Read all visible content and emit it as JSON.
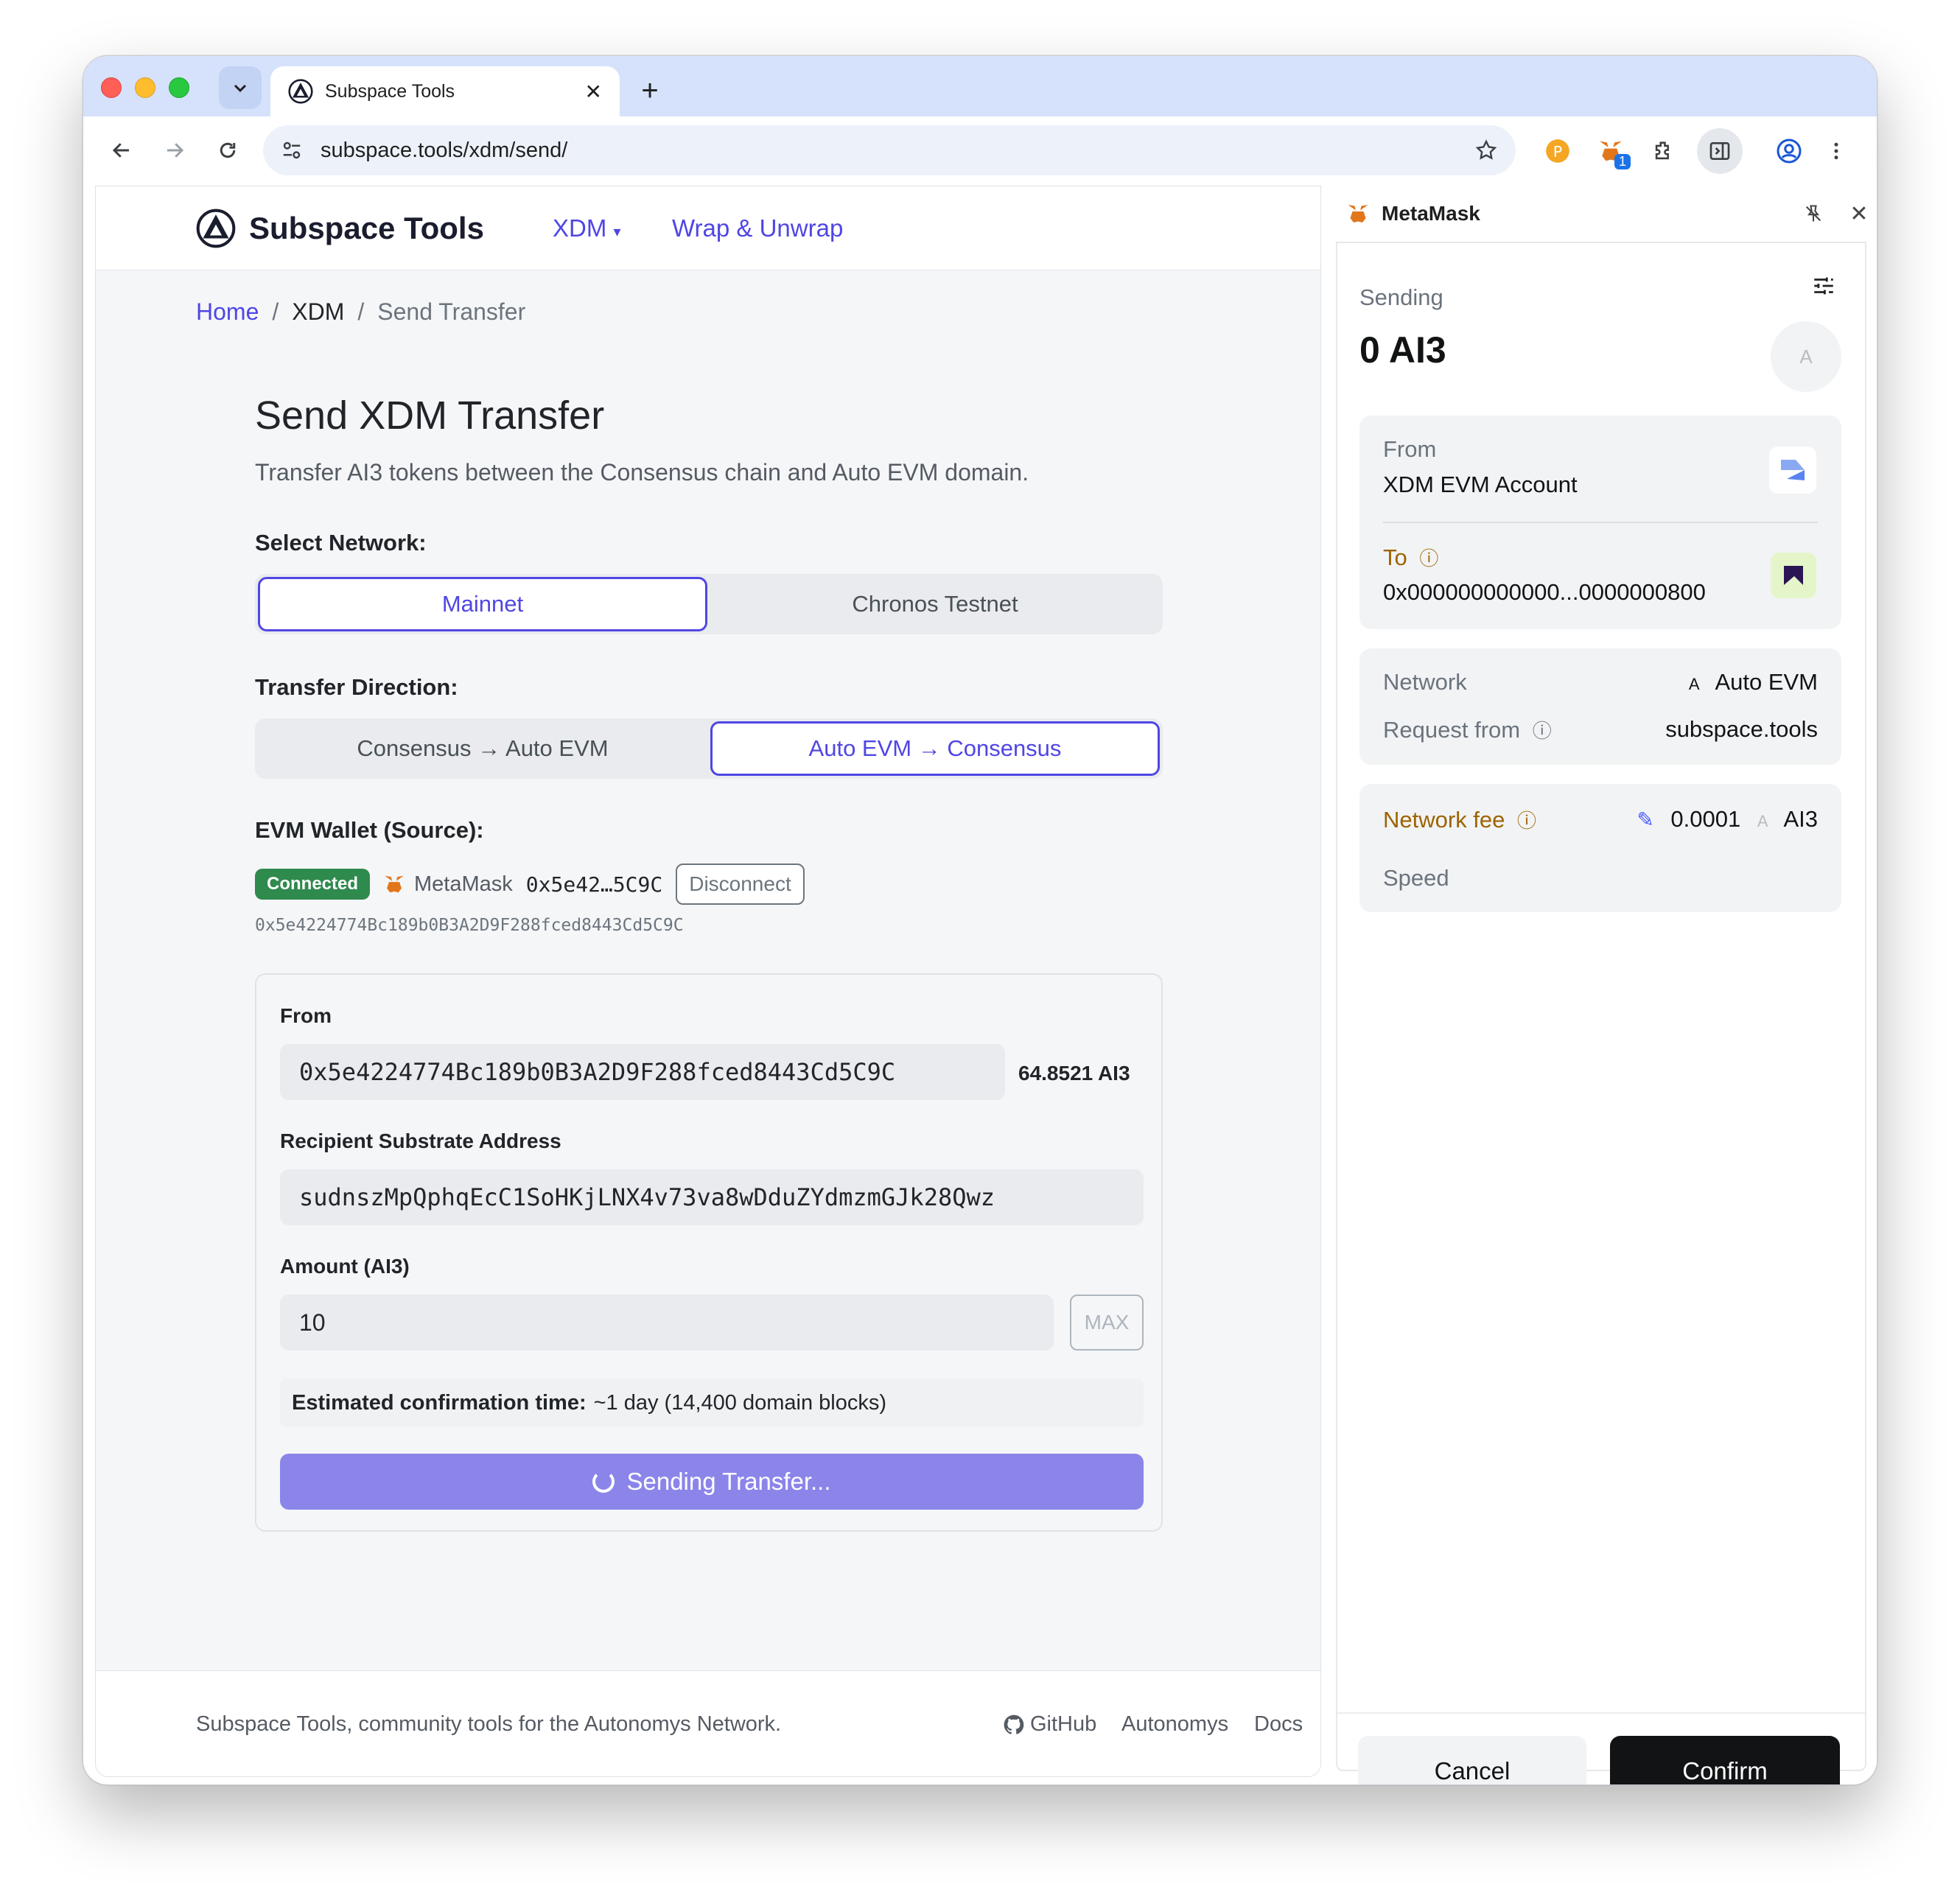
{
  "browser": {
    "tab_title": "Subspace Tools",
    "url": "subspace.tools/xdm/send/",
    "extension_badge": "1"
  },
  "site": {
    "brand": "Subspace Tools",
    "nav": {
      "xdm": "XDM",
      "wrap": "Wrap & Unwrap"
    },
    "breadcrumb": {
      "home": "Home",
      "xdm": "XDM",
      "current": "Send Transfer"
    },
    "title": "Send XDM Transfer",
    "lead": "Transfer AI3 tokens between the Consensus chain and Auto EVM domain.",
    "network": {
      "label": "Select Network:",
      "options": [
        "Mainnet",
        "Chronos Testnet"
      ],
      "selected": "Mainnet"
    },
    "direction": {
      "label": "Transfer Direction:",
      "options": [
        "Consensus → Auto EVM",
        "Auto EVM → Consensus"
      ],
      "selected": "Auto EVM → Consensus"
    },
    "wallet": {
      "label": "EVM Wallet (Source):",
      "status": "Connected",
      "name": "MetaMask",
      "short_address": "0x5e42…5C9C",
      "disconnect": "Disconnect",
      "full_address": "0x5e4224774Bc189b0B3A2D9F288fced8443Cd5C9C"
    },
    "form": {
      "from_label": "From",
      "from_value": "0x5e4224774Bc189b0B3A2D9F288fced8443Cd5C9C",
      "balance": "64.8521 AI3",
      "recipient_label": "Recipient Substrate Address",
      "recipient_value": "sudnszMpQphqEcC1SoHKjLNX4v73va8wDduZYdmzmGJk28Qwz",
      "amount_label": "Amount (AI3)",
      "amount_value": "10",
      "max": "MAX",
      "estimate_label": "Estimated confirmation time:",
      "estimate_value": "~1 day (14,400 domain blocks)",
      "submit": "Sending Transfer..."
    },
    "footer": {
      "text": "Subspace Tools, community tools for the Autonomys Network.",
      "github": "GitHub",
      "autonomys": "Autonomys",
      "docs": "Docs"
    }
  },
  "metamask": {
    "title": "MetaMask",
    "sending_label": "Sending",
    "amount": "0 AI3",
    "avatar_letter": "A",
    "from_label": "From",
    "from_value": "XDM EVM Account",
    "to_label": "To",
    "to_value": "0x000000000000...0000000800",
    "network_label": "Network",
    "network_value": "Auto EVM",
    "network_letter": "A",
    "request_label": "Request from",
    "request_value": "subspace.tools",
    "fee_label": "Network fee",
    "fee_value": "0.0001",
    "fee_unit": "AI3",
    "speed_label": "Speed",
    "cancel": "Cancel",
    "confirm": "Confirm"
  },
  "colors": {
    "accent": "#4f46e5",
    "connected": "#2f8a4e",
    "send_button": "#8b85ea",
    "metamask_warning": "#9c6400"
  }
}
